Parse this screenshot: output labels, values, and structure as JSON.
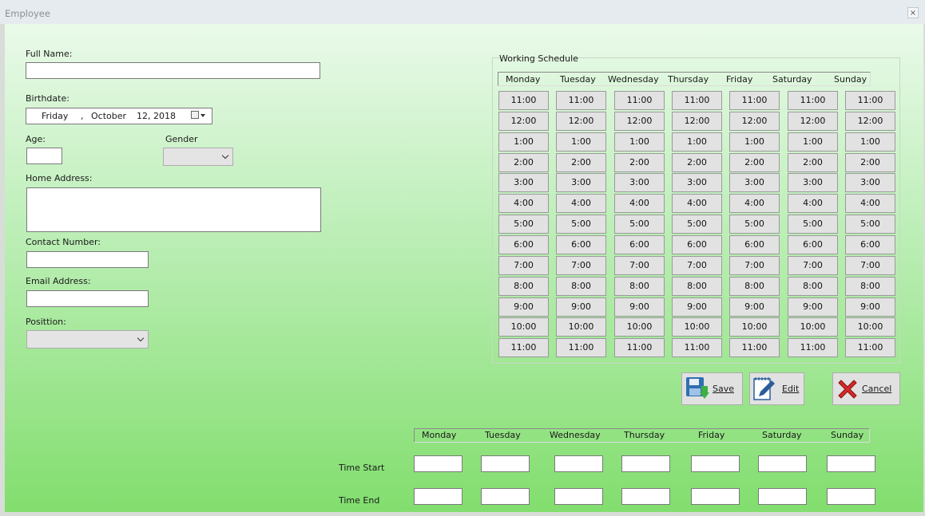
{
  "window": {
    "title": "Employee",
    "close_glyph": "×"
  },
  "form": {
    "full_name_label": "Full Name:",
    "full_name_value": "",
    "birthdate_label": "Birthdate:",
    "birthdate": {
      "weekday": "Friday",
      "separator": ",",
      "month": "October",
      "day": "12, 2018"
    },
    "age_label": "Age:",
    "age_value": "",
    "gender_label": "Gender",
    "gender_value": "",
    "home_address_label": "Home Address:",
    "home_address_value": "",
    "contact_label": "Contact Number:",
    "contact_value": "",
    "email_label": "Email Address:",
    "email_value": "",
    "position_label": "Posittion:",
    "position_value": ""
  },
  "schedule": {
    "title": "Working Schedule",
    "days": [
      "Monday",
      "Tuesday",
      "Wednesday",
      "Thursday",
      "Friday",
      "Saturday",
      "Sunday"
    ],
    "times": [
      "11:00",
      "12:00",
      "1:00",
      "2:00",
      "3:00",
      "4:00",
      "5:00",
      "6:00",
      "7:00",
      "8:00",
      "9:00",
      "10:00",
      "11:00"
    ]
  },
  "buttons": {
    "save": "Save",
    "edit": "Edit",
    "cancel": "Cancel"
  },
  "icons": {
    "save": "save-floppy-icon",
    "edit": "edit-pencil-icon",
    "cancel": "cancel-x-icon"
  },
  "time_table": {
    "days": [
      "Monday",
      "Tuesday",
      "Wednesday",
      "Thursday",
      "Friday",
      "Saturday",
      "Sunday"
    ],
    "start_label": "Time Start",
    "end_label": "Time End",
    "start_values": [
      "",
      "",
      "",
      "",
      "",
      "",
      ""
    ],
    "end_values": [
      "",
      "",
      "",
      "",
      "",
      "",
      ""
    ]
  },
  "colors": {
    "gradient_top": "#eafaea",
    "gradient_bottom": "#82de6e",
    "cancel_red": "#d42a2a",
    "save_blue": "#2f6fb0"
  }
}
